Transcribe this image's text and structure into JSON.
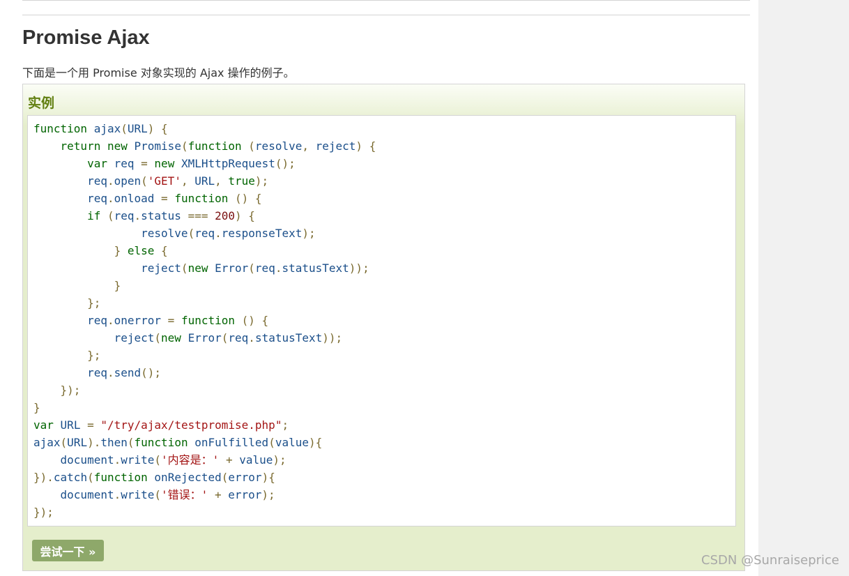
{
  "page": {
    "title": "Promise Ajax",
    "intro": "下面是一个用 Promise 对象实现的 Ajax 操作的例子。"
  },
  "example": {
    "label": "实例",
    "try_button": "尝试一下 »",
    "code_lines": [
      [
        [
          "kw",
          "function"
        ],
        [
          "p",
          " "
        ],
        [
          "id",
          "ajax"
        ],
        [
          "p",
          "("
        ],
        [
          "id",
          "URL"
        ],
        [
          "p",
          ") {"
        ]
      ],
      [
        [
          "p",
          "    "
        ],
        [
          "kw",
          "return"
        ],
        [
          "p",
          " "
        ],
        [
          "kw",
          "new"
        ],
        [
          "p",
          " "
        ],
        [
          "id",
          "Promise"
        ],
        [
          "p",
          "("
        ],
        [
          "kw",
          "function"
        ],
        [
          "p",
          " ("
        ],
        [
          "id",
          "resolve"
        ],
        [
          "p",
          ", "
        ],
        [
          "id",
          "reject"
        ],
        [
          "p",
          ") {"
        ]
      ],
      [
        [
          "p",
          "        "
        ],
        [
          "kw",
          "var"
        ],
        [
          "p",
          " "
        ],
        [
          "id",
          "req"
        ],
        [
          "p",
          " = "
        ],
        [
          "kw",
          "new"
        ],
        [
          "p",
          " "
        ],
        [
          "id",
          "XMLHttpRequest"
        ],
        [
          "p",
          "();"
        ]
      ],
      [
        [
          "p",
          "        "
        ],
        [
          "id",
          "req"
        ],
        [
          "p",
          "."
        ],
        [
          "id",
          "open"
        ],
        [
          "p",
          "("
        ],
        [
          "s",
          "'GET'"
        ],
        [
          "p",
          ", "
        ],
        [
          "id",
          "URL"
        ],
        [
          "p",
          ", "
        ],
        [
          "kw",
          "true"
        ],
        [
          "p",
          ");"
        ]
      ],
      [
        [
          "p",
          "        "
        ],
        [
          "id",
          "req"
        ],
        [
          "p",
          "."
        ],
        [
          "id",
          "onload"
        ],
        [
          "p",
          " = "
        ],
        [
          "kw",
          "function"
        ],
        [
          "p",
          " () {"
        ]
      ],
      [
        [
          "p",
          "        "
        ],
        [
          "kw",
          "if"
        ],
        [
          "p",
          " ("
        ],
        [
          "id",
          "req"
        ],
        [
          "p",
          "."
        ],
        [
          "id",
          "status"
        ],
        [
          "p",
          " === "
        ],
        [
          "n",
          "200"
        ],
        [
          "p",
          ") {"
        ]
      ],
      [
        [
          "p",
          "                "
        ],
        [
          "id",
          "resolve"
        ],
        [
          "p",
          "("
        ],
        [
          "id",
          "req"
        ],
        [
          "p",
          "."
        ],
        [
          "id",
          "responseText"
        ],
        [
          "p",
          ");"
        ]
      ],
      [
        [
          "p",
          "            } "
        ],
        [
          "kw",
          "else"
        ],
        [
          "p",
          " {"
        ]
      ],
      [
        [
          "p",
          "                "
        ],
        [
          "id",
          "reject"
        ],
        [
          "p",
          "("
        ],
        [
          "kw",
          "new"
        ],
        [
          "p",
          " "
        ],
        [
          "id",
          "Error"
        ],
        [
          "p",
          "("
        ],
        [
          "id",
          "req"
        ],
        [
          "p",
          "."
        ],
        [
          "id",
          "statusText"
        ],
        [
          "p",
          "));"
        ]
      ],
      [
        [
          "p",
          "            }"
        ]
      ],
      [
        [
          "p",
          "        };"
        ]
      ],
      [
        [
          "p",
          "        "
        ],
        [
          "id",
          "req"
        ],
        [
          "p",
          "."
        ],
        [
          "id",
          "onerror"
        ],
        [
          "p",
          " = "
        ],
        [
          "kw",
          "function"
        ],
        [
          "p",
          " () {"
        ]
      ],
      [
        [
          "p",
          "            "
        ],
        [
          "id",
          "reject"
        ],
        [
          "p",
          "("
        ],
        [
          "kw",
          "new"
        ],
        [
          "p",
          " "
        ],
        [
          "id",
          "Error"
        ],
        [
          "p",
          "("
        ],
        [
          "id",
          "req"
        ],
        [
          "p",
          "."
        ],
        [
          "id",
          "statusText"
        ],
        [
          "p",
          "));"
        ]
      ],
      [
        [
          "p",
          "        };"
        ]
      ],
      [
        [
          "p",
          "        "
        ],
        [
          "id",
          "req"
        ],
        [
          "p",
          "."
        ],
        [
          "id",
          "send"
        ],
        [
          "p",
          "();"
        ]
      ],
      [
        [
          "p",
          "    });"
        ]
      ],
      [
        [
          "p",
          "}"
        ]
      ],
      [
        [
          "kw",
          "var"
        ],
        [
          "p",
          " "
        ],
        [
          "id",
          "URL"
        ],
        [
          "p",
          " = "
        ],
        [
          "s",
          "\"/try/ajax/testpromise.php\""
        ],
        [
          "p",
          ";"
        ]
      ],
      [
        [
          "id",
          "ajax"
        ],
        [
          "p",
          "("
        ],
        [
          "id",
          "URL"
        ],
        [
          "p",
          ")."
        ],
        [
          "id",
          "then"
        ],
        [
          "p",
          "("
        ],
        [
          "kw",
          "function"
        ],
        [
          "p",
          " "
        ],
        [
          "id",
          "onFulfilled"
        ],
        [
          "p",
          "("
        ],
        [
          "id",
          "value"
        ],
        [
          "p",
          "){"
        ]
      ],
      [
        [
          "p",
          "    "
        ],
        [
          "id",
          "document"
        ],
        [
          "p",
          "."
        ],
        [
          "id",
          "write"
        ],
        [
          "p",
          "("
        ],
        [
          "s",
          "'内容是：'"
        ],
        [
          "p",
          " + "
        ],
        [
          "id",
          "value"
        ],
        [
          "p",
          ");"
        ]
      ],
      [
        [
          "p",
          "})."
        ],
        [
          "id",
          "catch"
        ],
        [
          "p",
          "("
        ],
        [
          "kw",
          "function"
        ],
        [
          "p",
          " "
        ],
        [
          "id",
          "onRejected"
        ],
        [
          "p",
          "("
        ],
        [
          "id",
          "error"
        ],
        [
          "p",
          "){"
        ]
      ],
      [
        [
          "p",
          "    "
        ],
        [
          "id",
          "document"
        ],
        [
          "p",
          "."
        ],
        [
          "id",
          "write"
        ],
        [
          "p",
          "("
        ],
        [
          "s",
          "'错误：'"
        ],
        [
          "p",
          " + "
        ],
        [
          "id",
          "error"
        ],
        [
          "p",
          ");"
        ]
      ],
      [
        [
          "p",
          "});"
        ]
      ]
    ]
  },
  "watermark": "CSDN @Sunraiseprice"
}
